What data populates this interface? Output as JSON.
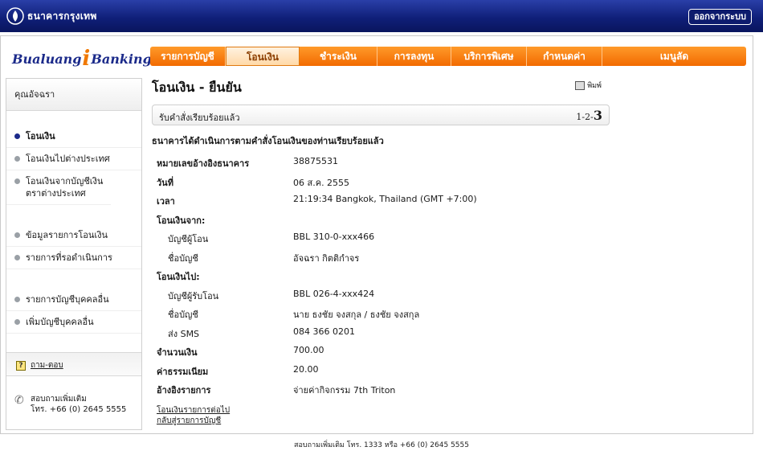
{
  "header": {
    "bank_name": "ธนาคารกรุงเทพ",
    "logout_label": "ออกจากระบบ"
  },
  "brand": {
    "left": "Bualuang",
    "mid": "i",
    "right": "Banking"
  },
  "nav": {
    "tabs": [
      {
        "label": "รายการบัญชี"
      },
      {
        "label": "โอนเงิน"
      },
      {
        "label": "ชำระเงิน"
      },
      {
        "label": "การลงทุน"
      },
      {
        "label": "บริการพิเศษ"
      },
      {
        "label": "กำหนดค่า"
      },
      {
        "label": "เมนูลัด"
      }
    ]
  },
  "sidebar": {
    "user": "คุณอัจฉรา",
    "items": [
      {
        "label": "โอนเงิน"
      },
      {
        "label": "โอนเงินไปต่างประเทศ"
      },
      {
        "label": "โอนเงินจากบัญชีเงินตราต่างประเทศ"
      },
      {
        "label": "ข้อมูลรายการโอนเงิน"
      },
      {
        "label": "รายการที่รอดำเนินการ"
      },
      {
        "label": "รายการบัญชีบุคคลอื่น"
      },
      {
        "label": "เพิ่มบัญชีบุคคลอื่น"
      }
    ],
    "help": "ถาม-ตอบ",
    "contact_title": "สอบถามเพิ่มเติม",
    "contact_phone": "โทร. +66 (0) 2645 5555"
  },
  "content": {
    "title": "โอนเงิน - ยืนยัน",
    "print_label": "พิมพ์",
    "status_message": "รับคำสั่งเรียบร้อยแล้ว",
    "step_prefix": "1-2-",
    "step_current": "3",
    "intro": "ธนาคารได้ดำเนินการตามคำสั่งโอนเงินของท่านเรียบร้อยแล้ว",
    "details": [
      {
        "key": "หมายเลขอ้างอิงธนาคาร",
        "value": "38875531"
      },
      {
        "key": "วันที่",
        "value": "06 ส.ค. 2555"
      },
      {
        "key": "เวลา",
        "value": "21:19:34 Bangkok, Thailand (GMT +7:00)"
      },
      {
        "key": "โอนเงินจาก:",
        "value": ""
      },
      {
        "key": "บัญชีผู้โอน",
        "value": "BBL 310-0-xxx466"
      },
      {
        "key": "ชื่อบัญชี",
        "value": "อัจฉรา กิตติกำจร"
      },
      {
        "key": "โอนเงินไป:",
        "value": ""
      },
      {
        "key": "บัญชีผู้รับโอน",
        "value": "BBL 026-4-xxx424"
      },
      {
        "key": "ชื่อบัญชี",
        "value": "นาย ธงชัย จงสกุล / ธงชัย จงสกุล"
      },
      {
        "key": "ส่ง SMS",
        "value": "084 366 0201"
      },
      {
        "key": "จำนวนเงิน",
        "value": "700.00"
      },
      {
        "key": "ค่าธรรมเนียม",
        "value": "20.00"
      },
      {
        "key": "อ้างอิงรายการ",
        "value": "จ่ายค่ากิจกรรม 7th Triton"
      }
    ],
    "link_next": "โอนเงินรายการต่อไป",
    "link_back": "กลับสู่รายการบัญชี"
  },
  "footer": "สอบถามเพิ่มเติม โทร. 1333 หรือ +66 (0) 2645 5555",
  "colors": {
    "header": "#0f1f78",
    "nav_orange": "#f26a00",
    "brand_blue": "#1b2a8a"
  }
}
